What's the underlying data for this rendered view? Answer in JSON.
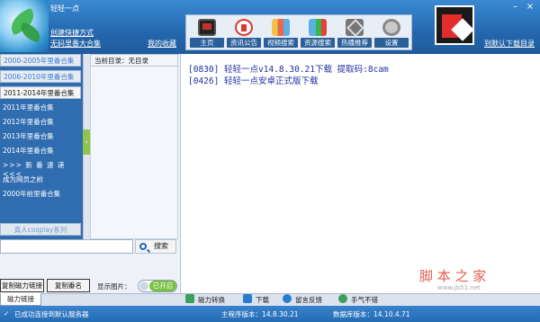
{
  "app": {
    "title": "轻轻一点"
  },
  "header": {
    "create_shortcut": "创建快捷方式",
    "no_code_collection": "无码里番大合集",
    "my_favorites": "我的收藏",
    "download_link": "到默认下载目录",
    "window_controls": {
      "minimize": "–",
      "close": "×"
    }
  },
  "nav": [
    {
      "label": "主页",
      "icon": "monitor-icon"
    },
    {
      "label": "资讯公告",
      "icon": "info-icon"
    },
    {
      "label": "视频搜索",
      "icon": "album-icon"
    },
    {
      "label": "资源搜索",
      "icon": "search-icon"
    },
    {
      "label": "热播推荐",
      "icon": "broadcast-icon"
    },
    {
      "label": "设置",
      "icon": "gear-icon"
    }
  ],
  "left": {
    "collections": [
      "2000-2005年里番合集",
      "2006-2010年里番合集",
      "2011-2014年里番合集"
    ],
    "active_collection": 2,
    "items": [
      "2011年里番合集",
      "2012年里番合集",
      "2013年里番合集",
      "2014年里番合集",
      ">>> 新 番 速 递 <<<",
      "成为网员之前",
      "2000年前里番合集"
    ],
    "footer": "真人cosplay系列",
    "current_dir": "当前目录：无目录",
    "search": {
      "value": "",
      "placeholder": "",
      "button": "搜索"
    },
    "copy_magnet": "复制磁力链接",
    "copy_name": "复制番名",
    "show_image_label": "显示图片：",
    "toggle_state": "已开启"
  },
  "right": {
    "notices": [
      "[0830] 轻轻一点v14.8.30.21下载 提取码:8cam",
      "[0426] 轻轻一点安卓正式版下载"
    ]
  },
  "bottom": {
    "tab_magnet": "磁力链接",
    "actions": [
      "磁力转换",
      "下载",
      "留言反馈",
      "手气不错"
    ]
  },
  "status": {
    "message": "已成功连接到默认服务器",
    "main_version": "主程序版本：14.8.30.21",
    "db_version": "数据库版本：14.10.4.71"
  },
  "watermark": {
    "text": "脚 本 之 家",
    "url": "www.jb51.net"
  }
}
